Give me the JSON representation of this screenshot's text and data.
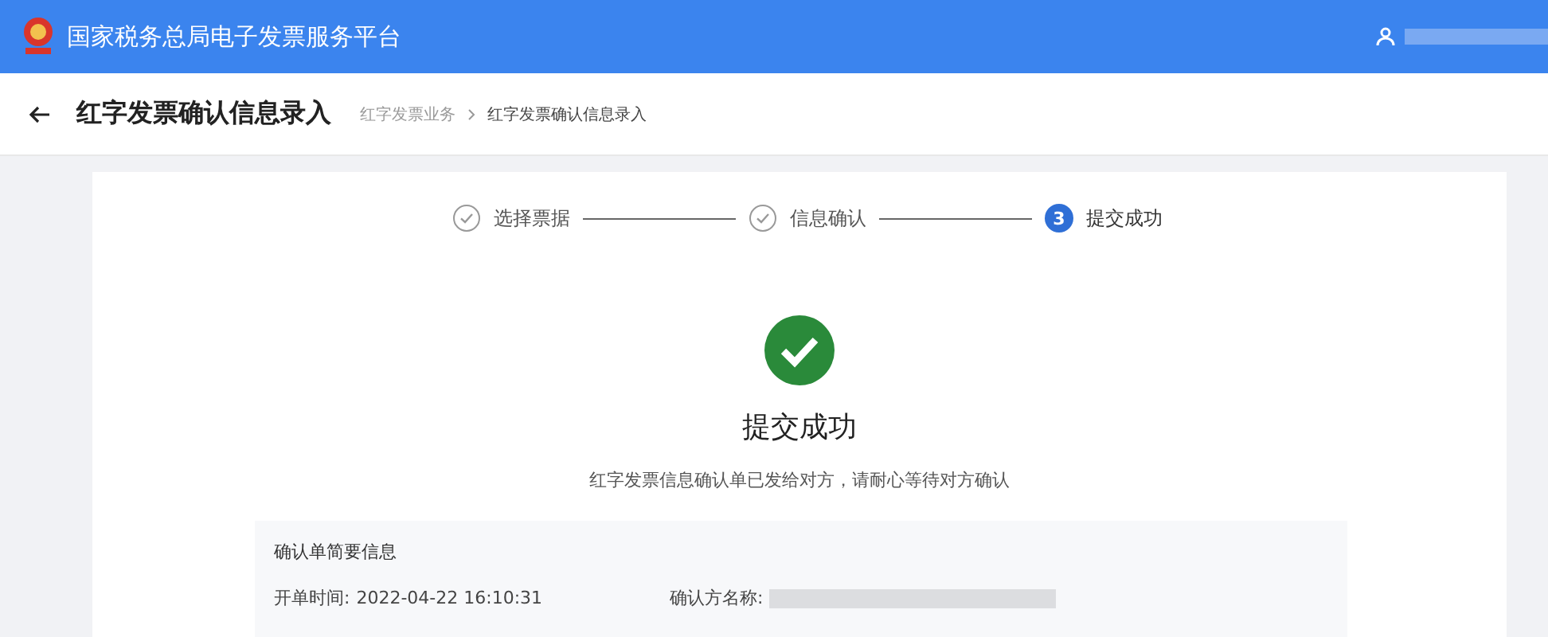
{
  "header": {
    "title": "国家税务总局电子发票服务平台"
  },
  "page": {
    "title": "红字发票确认信息录入",
    "breadcrumb": [
      {
        "label": "红字发票业务",
        "current": false
      },
      {
        "label": "红字发票确认信息录入",
        "current": true
      }
    ]
  },
  "steps": [
    {
      "label": "选择票据",
      "kind": "done"
    },
    {
      "label": "信息确认",
      "kind": "done"
    },
    {
      "label": "提交成功",
      "kind": "current",
      "number": "3"
    }
  ],
  "result": {
    "title": "提交成功",
    "message": "红字发票信息确认单已发给对方，请耐心等待对方确认"
  },
  "summary": {
    "title": "确认单简要信息",
    "fields": [
      {
        "label": "开单时间:",
        "value": "2022-04-22 16:10:31",
        "kind": "text"
      },
      {
        "label": "确认方名称:",
        "kind": "redacted"
      }
    ]
  }
}
